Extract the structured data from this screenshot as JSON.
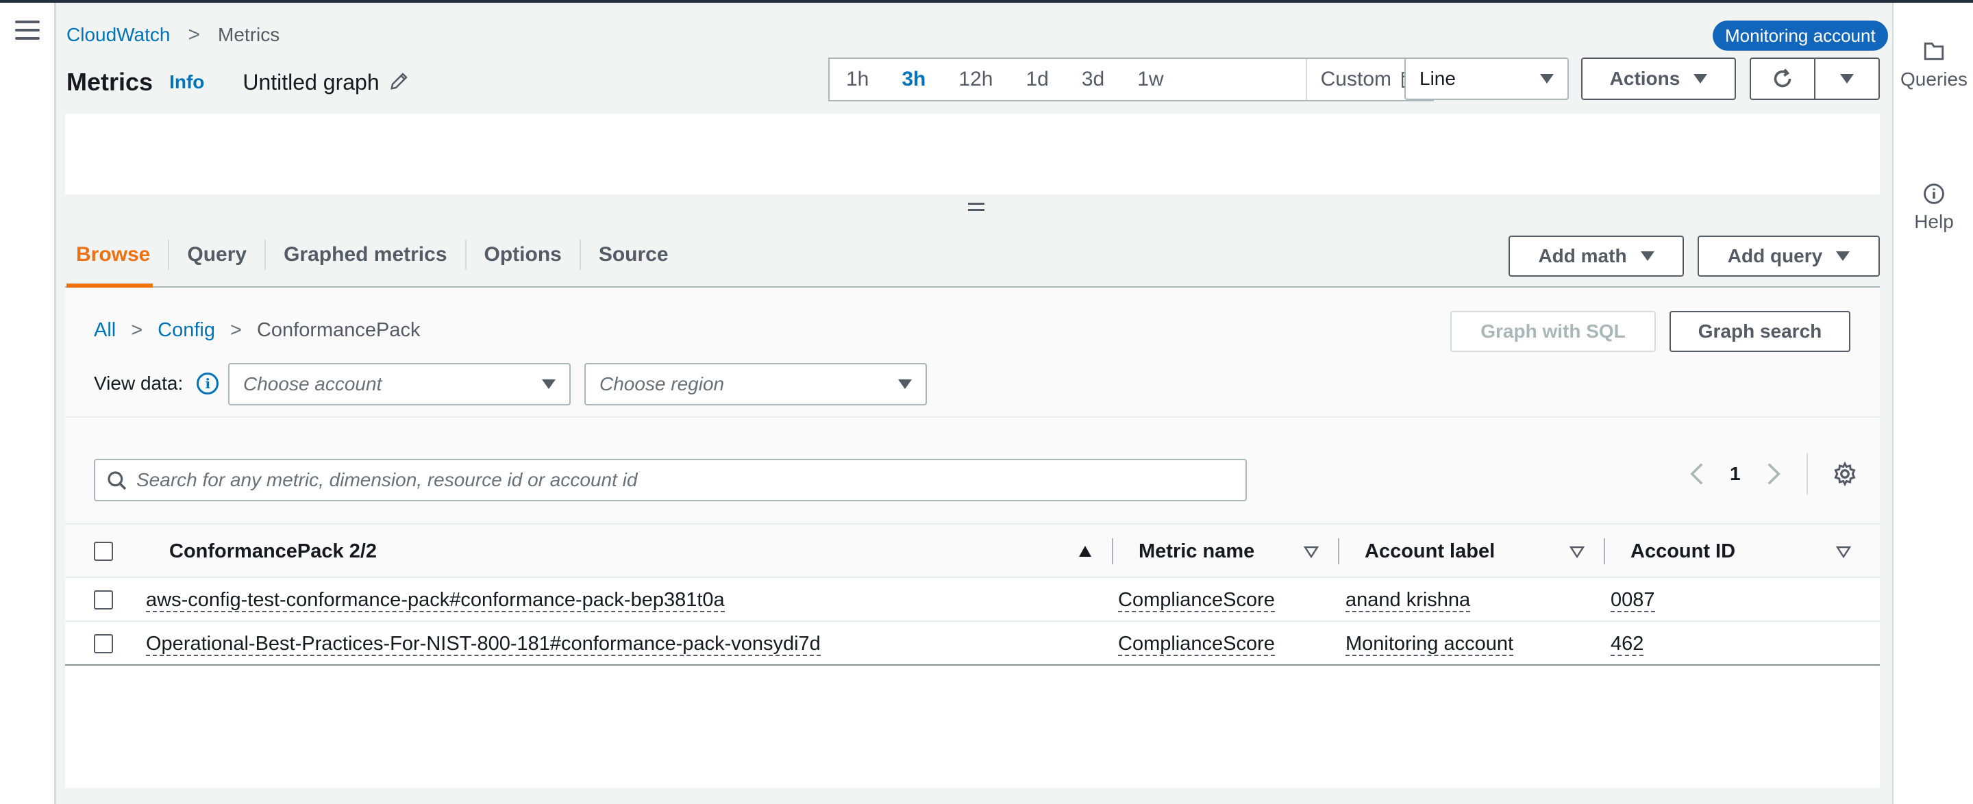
{
  "breadcrumb": {
    "root": "CloudWatch",
    "current": "Metrics"
  },
  "badge": "Monitoring account",
  "header": {
    "title": "Metrics",
    "info": "Info",
    "graph_name": "Untitled graph"
  },
  "time_ranges": [
    "1h",
    "3h",
    "12h",
    "1d",
    "3d",
    "1w"
  ],
  "active_time_range": "3h",
  "custom_label": "Custom",
  "chart_type": "Line",
  "actions_label": "Actions",
  "right_rail": {
    "queries": "Queries",
    "help": "Help"
  },
  "tabs": [
    "Browse",
    "Query",
    "Graphed metrics",
    "Options",
    "Source"
  ],
  "active_tab": "Browse",
  "add_math": "Add math",
  "add_query": "Add query",
  "browse_breadcrumb": {
    "all": "All",
    "namespace": "Config",
    "current": "ConformancePack"
  },
  "graph_with_sql": "Graph with SQL",
  "graph_search": "Graph search",
  "view_data": {
    "label": "View data:",
    "account_placeholder": "Choose account",
    "region_placeholder": "Choose region"
  },
  "search_placeholder": "Search for any metric, dimension, resource id or account id",
  "pager": {
    "page": "1"
  },
  "table": {
    "columns": [
      "ConformancePack 2/2",
      "Metric name",
      "Account label",
      "Account ID"
    ],
    "rows": [
      {
        "pack": "aws-config-test-conformance-pack#conformance-pack-bep381t0a",
        "metric": "ComplianceScore",
        "label": "anand krishna",
        "id": "0087"
      },
      {
        "pack": "Operational-Best-Practices-For-NIST-800-181#conformance-pack-vonsydi7d",
        "metric": "ComplianceScore",
        "label": "Monitoring account",
        "id": "462"
      }
    ]
  },
  "colors": {
    "link": "#0073bb",
    "active_tab": "#ec7211",
    "badge": "#1166bb"
  }
}
